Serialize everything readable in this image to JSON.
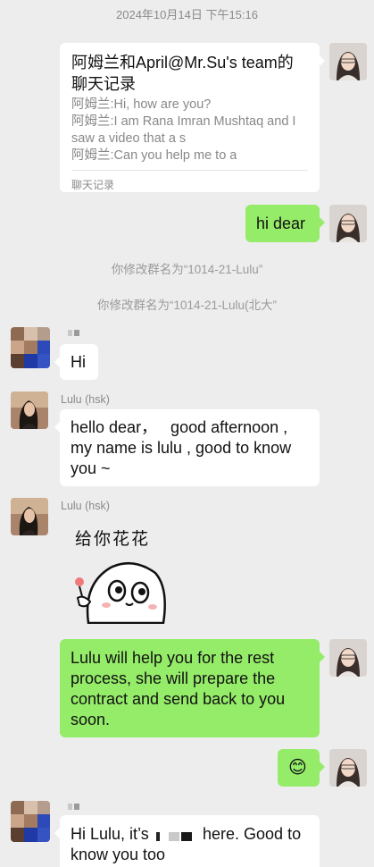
{
  "timestamp": "2024年10月14日 下午15:16",
  "chat_record_card": {
    "title_line1": "阿姆兰和April@Mr.Su's team的",
    "title_line2": "聊天记录",
    "lines": [
      "阿姆兰:Hi, how are you?",
      "阿姆兰:I am Rana Imran Mushtaq and I",
      "saw a video that a s",
      "阿姆兰:Can you help me to a"
    ],
    "footer": "聊天记录"
  },
  "messages": {
    "hi_dear": "hi dear",
    "sys_rename_1": "你修改群名为“1014-21-Lulu”",
    "sys_rename_2": "你修改群名为“1014-21-Lulu(北大”",
    "hi": "Hi",
    "lulu_sender_1": "Lulu (hsk)",
    "lulu_msg_1_l1": "hello dear，   good afternoon ,",
    "lulu_msg_1_l2": "my name is lulu , good to know",
    "lulu_msg_1_l3": "you ~",
    "lulu_sender_2": "Lulu (hsk)",
    "sticker_caption": "给你花花",
    "self_msg_l1": "Lulu will help you for the rest",
    "self_msg_l2": "process, she will prepare the",
    "self_msg_l3": "contract and send back to you",
    "self_msg_l4": "soon.",
    "emoji": "😊",
    "reply_l1_a": "Hi Lulu, it’s",
    "reply_l1_b": "here. Good to",
    "reply_l2": "know you too"
  },
  "icons": {
    "self_avatar": "woman-avatar-icon",
    "lulu_avatar": "lulu-avatar-icon",
    "other_avatar": "pixelated-avatar-icon",
    "sticker": "cartoon-sticker-icon"
  },
  "colors": {
    "background": "#ededed",
    "self_bubble": "#95ec69",
    "other_bubble": "#ffffff"
  }
}
